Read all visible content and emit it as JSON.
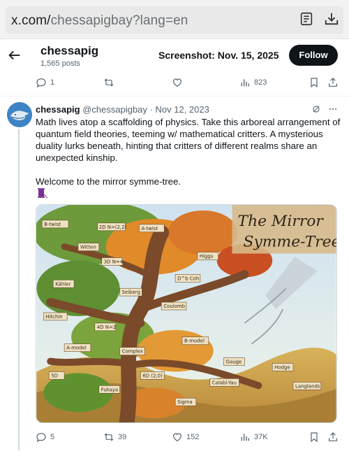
{
  "browser": {
    "url_domain": "x.com/",
    "url_path": "chessapigbay?lang=en"
  },
  "header": {
    "display_name": "chessapig",
    "posts_count": "1,565 posts",
    "stamp": "Screenshot: Nov. 15, 2025",
    "follow_label": "Follow"
  },
  "prev_actions": {
    "replies": "1",
    "retweets": "",
    "likes": "",
    "views": "823"
  },
  "tweet": {
    "name": "chessapig",
    "handle": "@chessapigbay",
    "separator": "·",
    "date": "Nov 12, 2023",
    "text": "Math lives atop a scaffolding of physics. Take this arboreal arrangement of quantum field theories, teeming w/ mathematical critters. A mysterious duality lurks beneath, hinting that critters of different realms share an unexpected kinship.",
    "text2": "Welcome to the mirror symme-tree.",
    "emoji": "thread-spool-emoji",
    "artwork": {
      "title_line1": "The Mirror",
      "title_line2": "Symme-Tree",
      "labels": [
        "B-twist",
        "A-twist",
        "2D N=(2,2)",
        "3D N=4",
        "4D N=2",
        "5D",
        "6D (2,0)",
        "A-model",
        "B-model",
        "Coulomb",
        "Higgs",
        "Kähler",
        "Complex",
        "Hodge",
        "Calabi-Yau",
        "Fukaya",
        "D^b Coh",
        "Langlands",
        "Hitchin",
        "Seiberg",
        "Witten",
        "Gauge",
        "Sigma"
      ]
    },
    "actions": {
      "replies": "5",
      "retweets": "39",
      "likes": "152",
      "views": "37K"
    }
  },
  "colors": {
    "follow_bg": "#0f1419",
    "secondary_text": "#536471",
    "avatar": "#3e84c4"
  }
}
